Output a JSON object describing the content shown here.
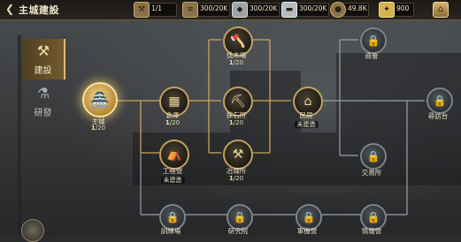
{
  "header": {
    "back_icon": "chevron-left-icon",
    "title": "主城建設",
    "home_icon": "home-icon"
  },
  "resources": [
    {
      "icon": "hammer-icon",
      "value": "1/1"
    },
    {
      "icon": "wood-icon",
      "value": "300/20K"
    },
    {
      "icon": "stone-icon",
      "value": "300/20K"
    },
    {
      "icon": "iron-icon",
      "value": "300/20K"
    },
    {
      "icon": "coin-icon",
      "value": "49.8K"
    },
    {
      "icon": "gold-icon",
      "value": "900"
    }
  ],
  "tabs": [
    {
      "label": "建設",
      "icon": "hammer-icon",
      "active": true
    },
    {
      "label": "研發",
      "icon": "flask-icon",
      "active": false
    }
  ],
  "nodes": {
    "main_city": {
      "name": "主城",
      "level": "1",
      "max": "/20",
      "icon": "castle-icon"
    },
    "warehouse": {
      "name": "倉庫",
      "level": "1",
      "max": "/20",
      "icon": "crates-icon"
    },
    "engineering": {
      "name": "工程營",
      "status": "未建造",
      "icon": "tent-icon"
    },
    "lumber": {
      "name": "伐木場",
      "level": "1",
      "max": "/20",
      "icon": "axe-icon"
    },
    "quarry": {
      "name": "採石所",
      "level": "1",
      "max": "/20",
      "icon": "pickaxe-icon"
    },
    "smelter": {
      "name": "冶煉所",
      "level": "1",
      "max": "/20",
      "icon": "furnace-icon"
    },
    "residence": {
      "name": "民居",
      "status": "未建造",
      "icon": "house-icon"
    },
    "shop": {
      "name": "商會",
      "icon": "lock-icon"
    },
    "market": {
      "name": "交易所",
      "icon": "lock-icon"
    },
    "visit": {
      "name": "尋訪台",
      "icon": "lock-icon"
    },
    "training": {
      "name": "訓練場",
      "icon": "lock-icon"
    },
    "research": {
      "name": "研究院",
      "icon": "lock-icon"
    },
    "military": {
      "name": "軍機營",
      "icon": "lock-icon"
    },
    "intel": {
      "name": "情報營",
      "icon": "lock-icon"
    }
  }
}
